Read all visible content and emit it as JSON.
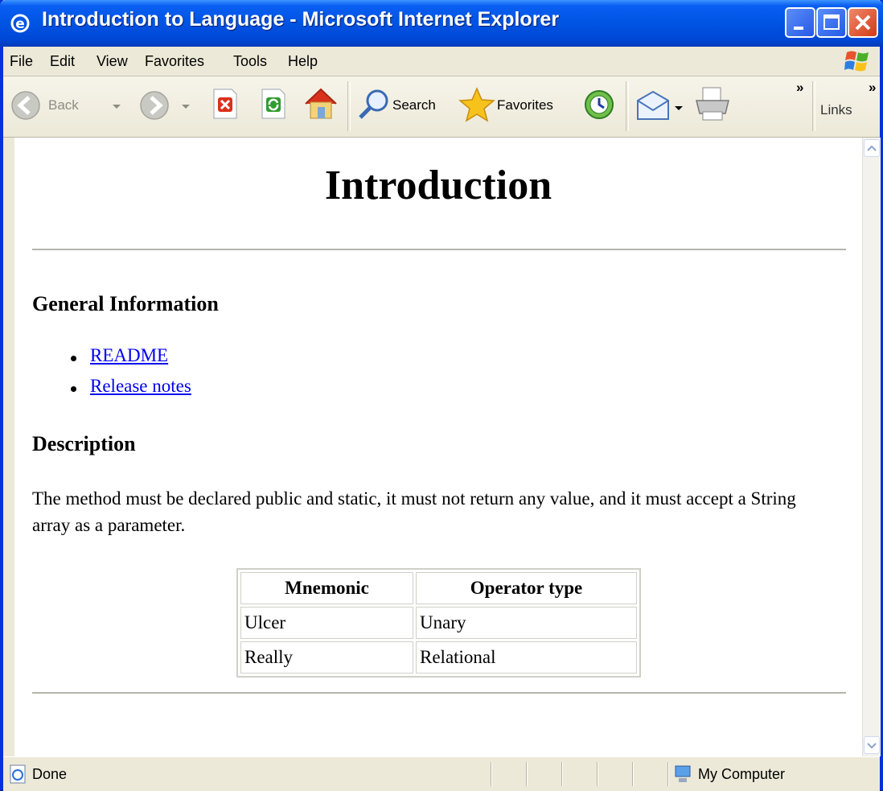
{
  "window": {
    "title": "Introduction to Language - Microsoft Internet Explorer"
  },
  "menu": [
    "File",
    "Edit",
    "View",
    "Favorites",
    "Tools",
    "Help"
  ],
  "toolbar": {
    "back": "Back",
    "search": "Search",
    "favorites": "Favorites",
    "links": "Links",
    "chevron": "»"
  },
  "page": {
    "heading": "Introduction",
    "general_heading": "General Information",
    "links": [
      "README",
      "Release notes"
    ],
    "description_heading": "Description",
    "description": "The method must be declared public and static, it must not return any value, and it must accept a String array as a parameter.",
    "table": {
      "headers": [
        "Mnemonic",
        "Operator type"
      ],
      "rows": [
        [
          "Ulcer",
          "Unary"
        ],
        [
          "Really",
          "Relational"
        ]
      ]
    }
  },
  "status": {
    "text": "Done",
    "zone": "My Computer"
  }
}
